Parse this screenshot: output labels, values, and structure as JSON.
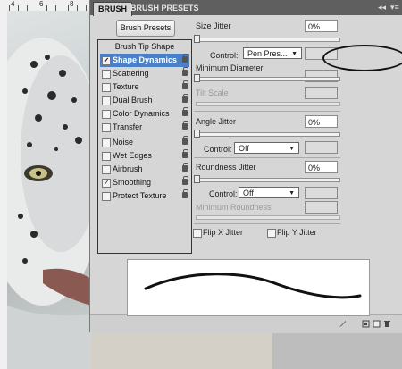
{
  "ruler": {
    "marks": [
      "4",
      "6",
      "8"
    ]
  },
  "tabs": [
    {
      "label": "BRUSH",
      "active": true
    },
    {
      "label": "BRUSH PRESETS",
      "active": false
    }
  ],
  "panel_controls": {
    "collapse": "◂◂",
    "menu": "▾≡"
  },
  "presets_button": "Brush Presets",
  "left_list": {
    "header": "Brush Tip Shape",
    "items": [
      {
        "label": "Shape Dynamics",
        "checked": true,
        "selected": true
      },
      {
        "label": "Scattering",
        "checked": false
      },
      {
        "label": "Texture",
        "checked": false
      },
      {
        "label": "Dual Brush",
        "checked": false
      },
      {
        "label": "Color Dynamics",
        "checked": false
      },
      {
        "label": "Transfer",
        "checked": false
      },
      {
        "label": "Noise",
        "checked": false
      },
      {
        "label": "Wet Edges",
        "checked": false
      },
      {
        "label": "Airbrush",
        "checked": false
      },
      {
        "label": "Smoothing",
        "checked": true
      },
      {
        "label": "Protect Texture",
        "checked": false
      }
    ],
    "check_mark": "✓"
  },
  "size_jitter": {
    "label": "Size Jitter",
    "value": "0%",
    "control_label": "Control:",
    "control_value": "Pen Pres...",
    "min_diameter_label": "Minimum Diameter",
    "tilt_scale_label": "Tilt Scale"
  },
  "angle_jitter": {
    "label": "Angle Jitter",
    "value": "0%",
    "control_label": "Control:",
    "control_value": "Off"
  },
  "roundness_jitter": {
    "label": "Roundness Jitter",
    "value": "0%",
    "control_label": "Control:",
    "control_value": "Off",
    "min_roundness_label": "Minimum Roundness"
  },
  "flip": {
    "x_label": "Flip X Jitter",
    "y_label": "Flip Y Jitter"
  },
  "dropdown_arrow": "▼",
  "colors": {
    "selection": "#4a80c8",
    "tabbar": "#5f5f5f",
    "panel": "#d6d6d6"
  },
  "bottom_icons": [
    "brush-tool-icon",
    "new-preset-icon",
    "create-new-icon",
    "delete-icon"
  ]
}
